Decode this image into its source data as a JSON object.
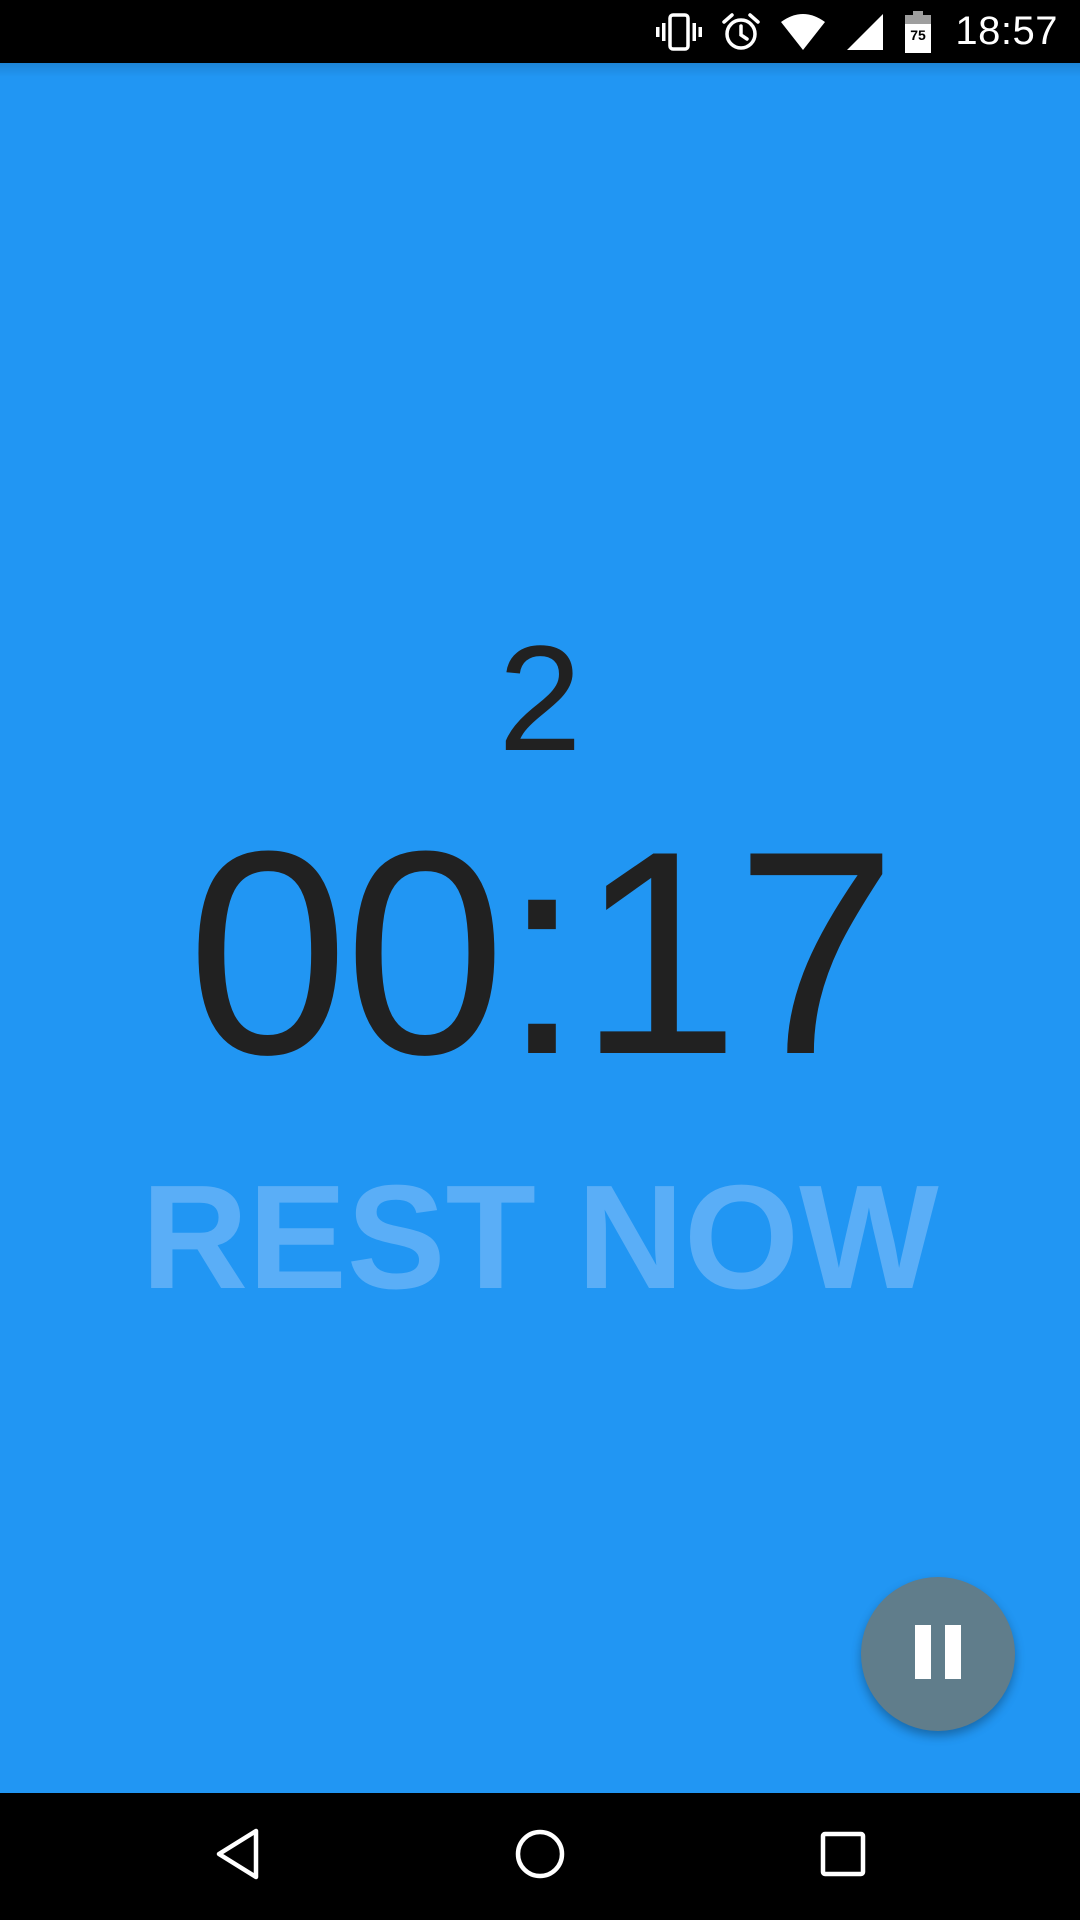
{
  "status_bar": {
    "time": "18:57",
    "battery_level": "75",
    "icons": [
      "vibrate-icon",
      "alarm-icon",
      "wifi-icon",
      "cell-signal-icon",
      "battery-icon"
    ]
  },
  "workout": {
    "round": "2",
    "timer": "00:17",
    "message": "REST NOW"
  },
  "fab": {
    "icon": "pause-icon"
  },
  "nav_bar": {
    "icons": [
      "back-icon",
      "home-icon",
      "recents-icon"
    ]
  },
  "colors": {
    "background": "#2196F3",
    "text_primary": "#212121",
    "message_text": "#5AAEF7",
    "fab": "#607D8B"
  }
}
